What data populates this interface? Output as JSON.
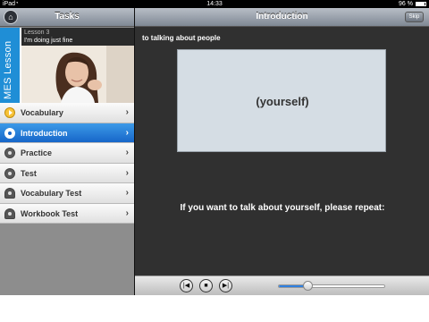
{
  "status_bar": {
    "carrier": "iPad",
    "time": "14:33",
    "battery": "96 %"
  },
  "left_pane": {
    "title": "Tasks",
    "lesson_tab": "MES Lesson",
    "lesson_number": "Lesson 3",
    "lesson_title": "I'm doing just fine",
    "menu": [
      {
        "label": "Vocabulary",
        "icon": "play-icon",
        "active": false
      },
      {
        "label": "Introduction",
        "icon": "record-icon",
        "active": true
      },
      {
        "label": "Practice",
        "icon": "record-icon",
        "active": false
      },
      {
        "label": "Test",
        "icon": "record-icon",
        "active": false
      },
      {
        "label": "Vocabulary Test",
        "icon": "person-icon",
        "active": false
      },
      {
        "label": "Workbook Test",
        "icon": "person-icon",
        "active": false
      }
    ]
  },
  "right_pane": {
    "title": "Introduction",
    "skip_label": "Skip",
    "topic": "to talking about people",
    "slide_word": "(yourself)",
    "prompt": "If you want to talk about yourself, please repeat:",
    "player": {
      "progress": 0.27
    }
  },
  "colors": {
    "accent": "#1f8ed6",
    "active_row": "#1766c9",
    "stage_bg": "#303030"
  }
}
